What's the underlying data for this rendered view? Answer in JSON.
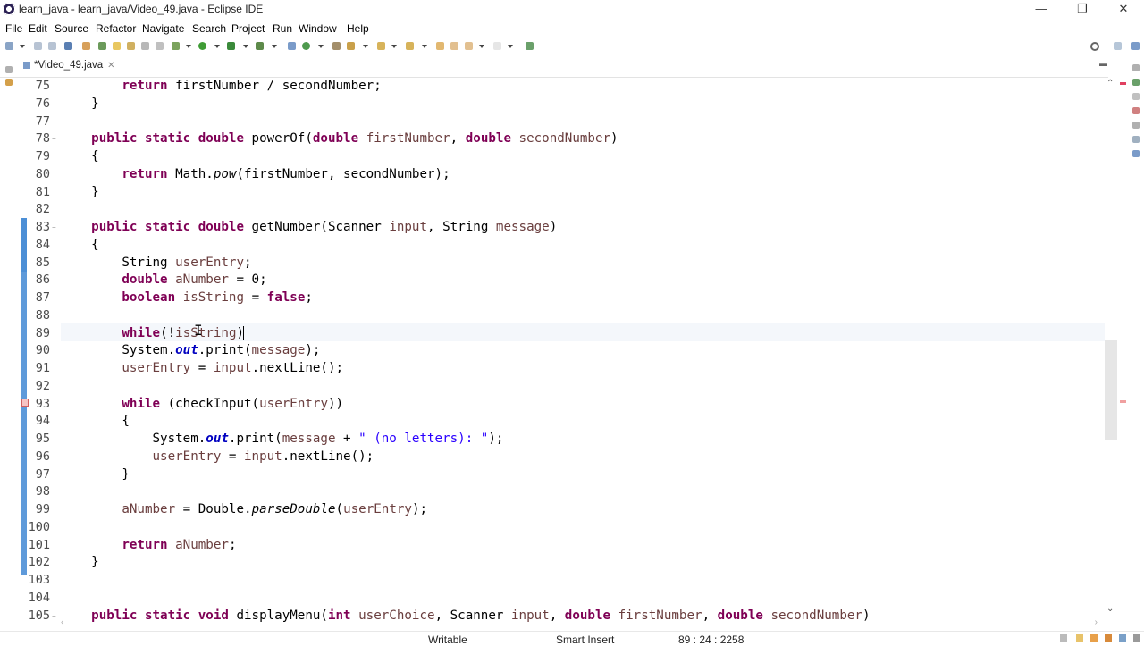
{
  "window": {
    "title": "learn_java - learn_java/Video_49.java - Eclipse IDE",
    "minimize": "—",
    "maximize": "❐",
    "close": "✕"
  },
  "menu": [
    "File",
    "Edit",
    "Source",
    "Refactor",
    "Navigate",
    "Search",
    "Project",
    "Run",
    "Window",
    "Help"
  ],
  "toolbar": {
    "search_icon": "search-icon",
    "perspective_icons": [
      "open-perspective-icon",
      "java-perspective-icon"
    ]
  },
  "editor": {
    "tab_label": "*Video_49.java",
    "tab_close": "✕",
    "lines": [
      {
        "n": "75",
        "segs": [
          [
            "",
            "        "
          ],
          [
            "kw",
            "return"
          ],
          [
            "",
            " firstNumber / secondNumber;"
          ]
        ]
      },
      {
        "n": "76",
        "segs": [
          [
            "",
            "    }"
          ]
        ]
      },
      {
        "n": "77",
        "segs": [
          [
            "",
            ""
          ]
        ]
      },
      {
        "n": "78",
        "fold": "⊖",
        "segs": [
          [
            "",
            "    "
          ],
          [
            "kw",
            "public static double"
          ],
          [
            "",
            " powerOf("
          ],
          [
            "kw",
            "double"
          ],
          [
            "",
            " "
          ],
          [
            "var",
            "firstNumber"
          ],
          [
            "",
            ", "
          ],
          [
            "kw",
            "double"
          ],
          [
            "",
            " "
          ],
          [
            "var",
            "secondNumber"
          ],
          [
            "",
            ")"
          ]
        ]
      },
      {
        "n": "79",
        "segs": [
          [
            "",
            "    {"
          ]
        ]
      },
      {
        "n": "80",
        "segs": [
          [
            "",
            "        "
          ],
          [
            "kw",
            "return"
          ],
          [
            "",
            " Math."
          ],
          [
            "it",
            "pow"
          ],
          [
            "",
            "(firstNumber, secondNumber);"
          ]
        ]
      },
      {
        "n": "81",
        "segs": [
          [
            "",
            "    }"
          ]
        ]
      },
      {
        "n": "82",
        "segs": [
          [
            "",
            ""
          ]
        ]
      },
      {
        "n": "83",
        "fold": "⊖",
        "segs": [
          [
            "",
            "    "
          ],
          [
            "kw",
            "public static double"
          ],
          [
            "",
            " getNumber(Scanner "
          ],
          [
            "var",
            "input"
          ],
          [
            "",
            ", String "
          ],
          [
            "var",
            "message"
          ],
          [
            "",
            ")"
          ]
        ]
      },
      {
        "n": "84",
        "segs": [
          [
            "",
            "    {"
          ]
        ]
      },
      {
        "n": "85",
        "segs": [
          [
            "",
            "        String "
          ],
          [
            "var",
            "userEntry"
          ],
          [
            "",
            ";"
          ]
        ]
      },
      {
        "n": "86",
        "segs": [
          [
            "",
            "        "
          ],
          [
            "kw",
            "double"
          ],
          [
            "",
            " "
          ],
          [
            "var",
            "aNumber"
          ],
          [
            "",
            " = 0;"
          ]
        ]
      },
      {
        "n": "87",
        "segs": [
          [
            "",
            "        "
          ],
          [
            "kw",
            "boolean"
          ],
          [
            "",
            " "
          ],
          [
            "var",
            "isString"
          ],
          [
            "",
            " = "
          ],
          [
            "kw",
            "false"
          ],
          [
            "",
            ";"
          ]
        ]
      },
      {
        "n": "88",
        "segs": [
          [
            "",
            ""
          ]
        ]
      },
      {
        "n": "89",
        "segs": [
          [
            "",
            "        "
          ],
          [
            "kw",
            "while"
          ],
          [
            "",
            "(!"
          ],
          [
            "var",
            "isString"
          ],
          [
            "",
            ")"
          ]
        ]
      },
      {
        "n": "90",
        "segs": [
          [
            "",
            "        System."
          ],
          [
            "fld",
            "out"
          ],
          [
            "",
            ".print("
          ],
          [
            "var",
            "message"
          ],
          [
            "",
            ");"
          ]
        ]
      },
      {
        "n": "91",
        "segs": [
          [
            "",
            "        "
          ],
          [
            "var",
            "userEntry"
          ],
          [
            "",
            " = "
          ],
          [
            "var",
            "input"
          ],
          [
            "",
            ".nextLine();"
          ]
        ]
      },
      {
        "n": "92",
        "segs": [
          [
            "",
            ""
          ]
        ]
      },
      {
        "n": "93",
        "segs": [
          [
            "",
            "        "
          ],
          [
            "kw",
            "while"
          ],
          [
            "",
            " (checkInput("
          ],
          [
            "var",
            "userEntry"
          ],
          [
            "",
            "))"
          ]
        ]
      },
      {
        "n": "94",
        "segs": [
          [
            "",
            "        {"
          ]
        ]
      },
      {
        "n": "95",
        "segs": [
          [
            "",
            "            System."
          ],
          [
            "fld",
            "out"
          ],
          [
            "",
            ".print("
          ],
          [
            "var",
            "message"
          ],
          [
            "",
            " + "
          ],
          [
            "str",
            "\" (no letters): \""
          ],
          [
            "",
            ");"
          ]
        ]
      },
      {
        "n": "96",
        "segs": [
          [
            "",
            "            "
          ],
          [
            "var",
            "userEntry"
          ],
          [
            "",
            " = "
          ],
          [
            "var",
            "input"
          ],
          [
            "",
            ".nextLine();"
          ]
        ]
      },
      {
        "n": "97",
        "segs": [
          [
            "",
            "        }"
          ]
        ]
      },
      {
        "n": "98",
        "segs": [
          [
            "",
            ""
          ]
        ]
      },
      {
        "n": "99",
        "segs": [
          [
            "",
            "        "
          ],
          [
            "var",
            "aNumber"
          ],
          [
            "",
            " = Double."
          ],
          [
            "it",
            "parseDouble"
          ],
          [
            "",
            "("
          ],
          [
            "var",
            "userEntry"
          ],
          [
            "",
            ");"
          ]
        ]
      },
      {
        "n": "100",
        "segs": [
          [
            "",
            ""
          ]
        ]
      },
      {
        "n": "101",
        "segs": [
          [
            "",
            "        "
          ],
          [
            "kw",
            "return"
          ],
          [
            "",
            " "
          ],
          [
            "var",
            "aNumber"
          ],
          [
            "",
            ";"
          ]
        ]
      },
      {
        "n": "102",
        "segs": [
          [
            "",
            "    }"
          ]
        ]
      },
      {
        "n": "103",
        "segs": [
          [
            "",
            ""
          ]
        ]
      },
      {
        "n": "104",
        "segs": [
          [
            "",
            ""
          ]
        ]
      },
      {
        "n": "105",
        "fold": "⊖",
        "segs": [
          [
            "",
            "    "
          ],
          [
            "kw",
            "public static void"
          ],
          [
            "",
            " displayMenu("
          ],
          [
            "kw",
            "int"
          ],
          [
            "",
            " "
          ],
          [
            "var",
            "userChoice"
          ],
          [
            "",
            ", Scanner "
          ],
          [
            "var",
            "input"
          ],
          [
            "",
            ", "
          ],
          [
            "kw",
            "double"
          ],
          [
            "",
            " "
          ],
          [
            "var",
            "firstNumber"
          ],
          [
            "",
            ", "
          ],
          [
            "kw",
            "double"
          ],
          [
            "",
            " "
          ],
          [
            "var",
            "secondNumber"
          ],
          [
            "",
            ")"
          ]
        ]
      }
    ]
  },
  "status": {
    "writable": "Writable",
    "insert_mode": "Smart Insert",
    "position": "89 : 24 : 2258"
  },
  "colors": {
    "keyword": "#7f0055",
    "local_variable": "#6a3e3e",
    "string": "#2a00ff",
    "field": "#0000c0",
    "change_bar": "#4c8fd6",
    "current_line": "#f4f7fb"
  }
}
